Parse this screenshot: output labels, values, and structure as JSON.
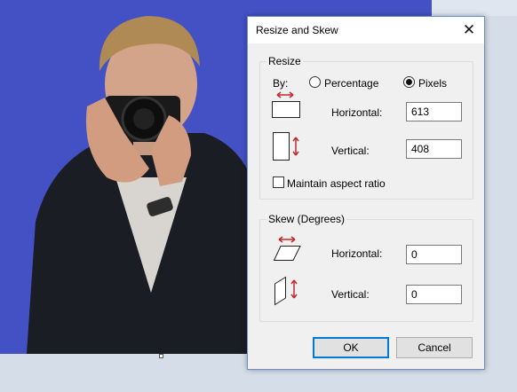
{
  "dialog": {
    "title": "Resize and Skew",
    "close_glyph": "✕"
  },
  "resize": {
    "group_label": "Resize",
    "by_label": "By:",
    "percentage_label": "Percentage",
    "pixels_label": "Pixels",
    "selected_unit": "Pixels",
    "horizontal_label": "Horizontal:",
    "horizontal_value": "613",
    "vertical_label": "Vertical:",
    "vertical_value": "408",
    "maintain_aspect_label": "Maintain aspect ratio",
    "maintain_aspect_checked": false
  },
  "skew": {
    "group_label": "Skew (Degrees)",
    "horizontal_label": "Horizontal:",
    "horizontal_value": "0",
    "vertical_label": "Vertical:",
    "vertical_value": "0"
  },
  "buttons": {
    "ok_label": "OK",
    "cancel_label": "Cancel"
  },
  "colors": {
    "canvas_background": "#4451c4",
    "arrow_red": "#c0282d",
    "accent_focus": "#0078d7"
  },
  "icons": {
    "resize_horizontal": "resize-horizontal-icon",
    "resize_vertical": "resize-vertical-icon",
    "skew_horizontal": "skew-horizontal-icon",
    "skew_vertical": "skew-vertical-icon"
  }
}
